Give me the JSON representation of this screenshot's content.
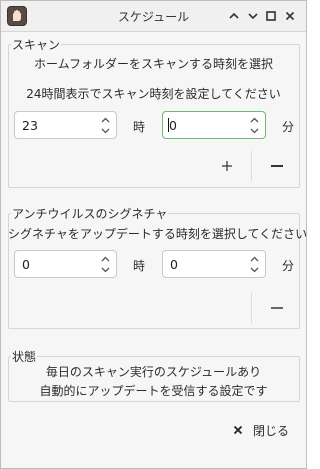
{
  "window": {
    "title": "スケジュール"
  },
  "scan": {
    "group_title": "スキャン",
    "description": "ホームフォルダーをスキャンする時刻を選択",
    "hint": "24時間表示でスキャン時刻を設定してください",
    "hour_value": "23",
    "hour_unit": "時",
    "minute_value": "0",
    "minute_unit": "分",
    "add_icon": "plus-icon",
    "remove_icon": "minus-icon"
  },
  "antivirus": {
    "group_title": "アンチウイルスのシグネチャ",
    "description": "シグネチャをアップデートする時刻を選択してください",
    "hour_value": "0",
    "hour_unit": "時",
    "minute_value": "0",
    "minute_unit": "分",
    "remove_icon": "minus-icon"
  },
  "status": {
    "group_title": "状態",
    "line1": "毎日のスキャン実行のスケジュールあり",
    "line2": "自動的にアップデートを受信する設定です"
  },
  "footer": {
    "close_label": "閉じる",
    "close_icon": "close-icon"
  },
  "colors": {
    "focus_border": "#6eb96e",
    "app_icon": "#5b4a43"
  }
}
